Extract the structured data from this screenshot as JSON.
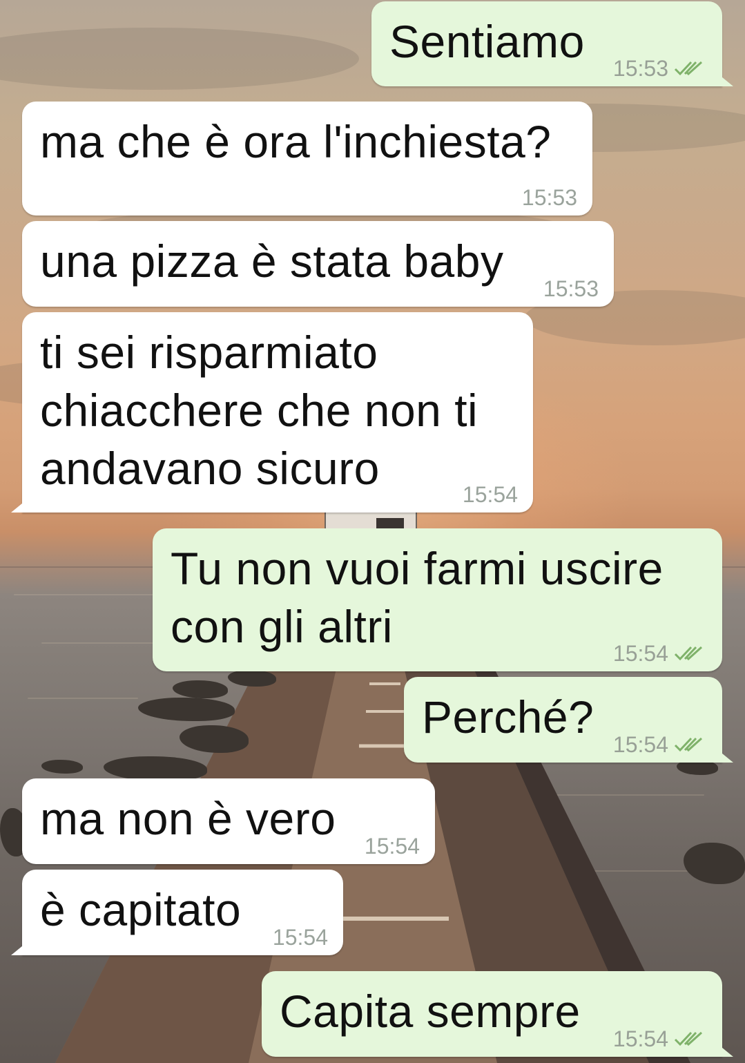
{
  "messages": [
    {
      "direction": "out",
      "text": "Sentiamo",
      "time": "15:53",
      "status_icon": "double-check-delivered-icon"
    },
    {
      "direction": "in",
      "text": "ma che è ora l'inchiesta?",
      "time": "15:53"
    },
    {
      "direction": "in",
      "text": "una pizza è stata baby",
      "time": "15:53"
    },
    {
      "direction": "in",
      "text": "ti sei risparmiato chiacchere che non ti andavano sicuro",
      "time": "15:54"
    },
    {
      "direction": "out",
      "text": "Tu non vuoi farmi uscire con gli altri",
      "time": "15:54",
      "status_icon": "double-check-delivered-icon"
    },
    {
      "direction": "out",
      "text": "Perché?",
      "time": "15:54",
      "status_icon": "double-check-delivered-icon"
    },
    {
      "direction": "in",
      "text": "ma non è vero",
      "time": "15:54"
    },
    {
      "direction": "in",
      "text": "è capitato",
      "time": "15:54"
    },
    {
      "direction": "out",
      "text": "Capita sempre",
      "time": "15:54",
      "status_icon": "double-check-delivered-icon"
    }
  ],
  "colors": {
    "incoming_bubble": "#ffffff",
    "outgoing_bubble": "#e5f7db",
    "message_text": "#111111",
    "timestamp": "#9aa39c",
    "delivered_ticks": "#7fb26a"
  },
  "wallpaper": "sunset-pier-photo"
}
